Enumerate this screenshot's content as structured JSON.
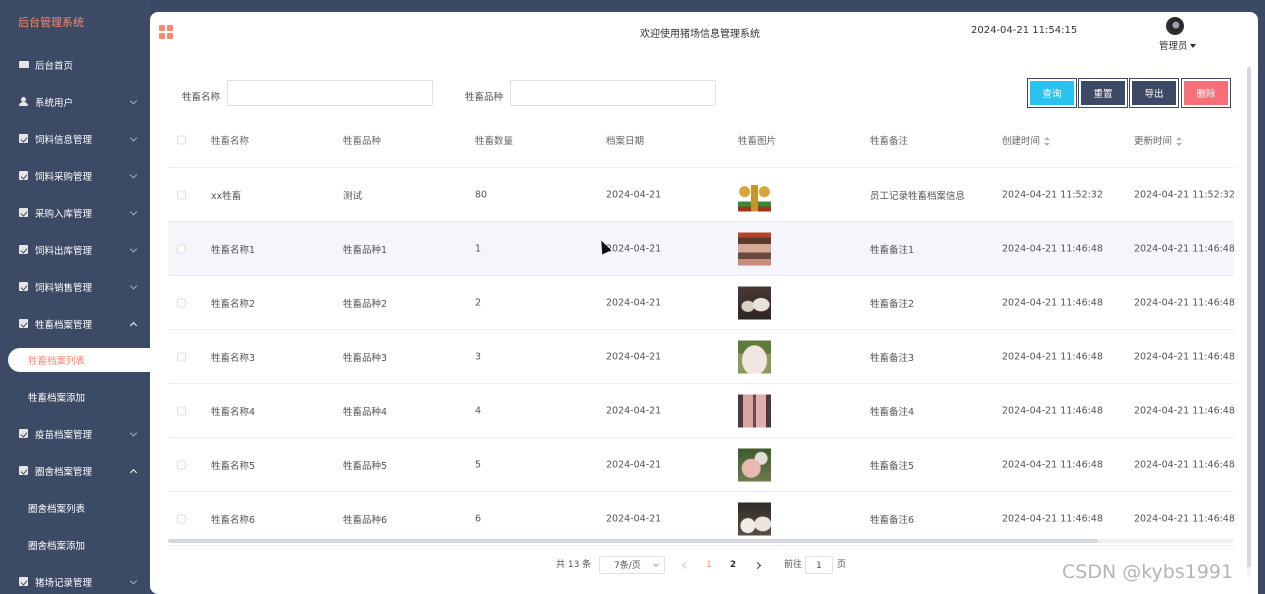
{
  "sidebar": {
    "title": "后台管理系统",
    "items": [
      {
        "label": "后台首页",
        "icon": "monitor-icon"
      },
      {
        "label": "系统用户",
        "icon": "user-icon"
      },
      {
        "label": "饲料信息管理",
        "icon": "checkbox-icon"
      },
      {
        "label": "饲料采购管理",
        "icon": "checkbox-icon"
      },
      {
        "label": "采购入库管理",
        "icon": "checkbox-icon"
      },
      {
        "label": "饲料出库管理",
        "icon": "checkbox-icon"
      },
      {
        "label": "饲料销售管理",
        "icon": "checkbox-icon"
      },
      {
        "label": "牲畜档案管理",
        "icon": "checkbox-icon",
        "expanded": true
      },
      {
        "label": "疫苗档案管理",
        "icon": "checkbox-icon"
      },
      {
        "label": "圈舍档案管理",
        "icon": "checkbox-icon",
        "expanded": true
      },
      {
        "label": "猪场记录管理",
        "icon": "checkbox-icon"
      }
    ],
    "sub_livestock": [
      "牲畜档案列表",
      "牲畜档案添加"
    ],
    "sub_pen": [
      "圈舍档案列表",
      "圈舍档案添加"
    ]
  },
  "header": {
    "welcome": "欢迎使用猪场信息管理系统",
    "datetime": "2024-04-21 11:54:15",
    "user": "管理员"
  },
  "search": {
    "name_label": "牲畜名称",
    "breed_label": "牲畜品种",
    "name_value": "",
    "breed_value": "",
    "buttons": {
      "query": "查询",
      "reset": "重置",
      "export": "导出",
      "delete": "删除"
    }
  },
  "table": {
    "columns": [
      "牲畜名称",
      "牲畜品种",
      "牲畜数量",
      "档案日期",
      "牲畜图片",
      "牲畜备注",
      "创建时间",
      "更新时间"
    ],
    "rows": [
      {
        "name": "xx牲畜",
        "breed": "测试",
        "count": "80",
        "date": "2024-04-21",
        "image": "scale-image",
        "remark": "员工记录牲畜档案信息",
        "created": "2024-04-21 11:52:32",
        "updated": "2024-04-21 11:52:32"
      },
      {
        "name": "牲畜名称1",
        "breed": "牲畜品种1",
        "count": "1",
        "date": "2024-04-21",
        "image": "pig-image",
        "remark": "牲畜备注1",
        "created": "2024-04-21 11:46:48",
        "updated": "2024-04-21 11:46:48"
      },
      {
        "name": "牲畜名称2",
        "breed": "牲畜品种2",
        "count": "2",
        "date": "2024-04-21",
        "image": "pig-image",
        "remark": "牲畜备注2",
        "created": "2024-04-21 11:46:48",
        "updated": "2024-04-21 11:46:48"
      },
      {
        "name": "牲畜名称3",
        "breed": "牲畜品种3",
        "count": "3",
        "date": "2024-04-21",
        "image": "pig-image",
        "remark": "牲畜备注3",
        "created": "2024-04-21 11:46:48",
        "updated": "2024-04-21 11:46:48"
      },
      {
        "name": "牲畜名称4",
        "breed": "牲畜品种4",
        "count": "4",
        "date": "2024-04-21",
        "image": "pig-image",
        "remark": "牲畜备注4",
        "created": "2024-04-21 11:46:48",
        "updated": "2024-04-21 11:46:48"
      },
      {
        "name": "牲畜名称5",
        "breed": "牲畜品种5",
        "count": "5",
        "date": "2024-04-21",
        "image": "pig-image",
        "remark": "牲畜备注5",
        "created": "2024-04-21 11:46:48",
        "updated": "2024-04-21 11:46:48"
      },
      {
        "name": "牲畜名称6",
        "breed": "牲畜品种6",
        "count": "6",
        "date": "2024-04-21",
        "image": "pig-image",
        "remark": "牲畜备注6",
        "created": "2024-04-21 11:46:48",
        "updated": "2024-04-21 11:46:48"
      }
    ]
  },
  "pagination": {
    "total": "共 13 条",
    "page_size": "7条/页",
    "pages": [
      "1",
      "2"
    ],
    "current": "1",
    "goto_label": "前往",
    "goto_value": "1",
    "page_suffix": "页"
  },
  "watermark": "CSDN @kybs1991",
  "colors": {
    "accent": "#f6896f",
    "sidebar": "#3d4a66",
    "query": "#29c3ef",
    "delete": "#f96f78"
  }
}
